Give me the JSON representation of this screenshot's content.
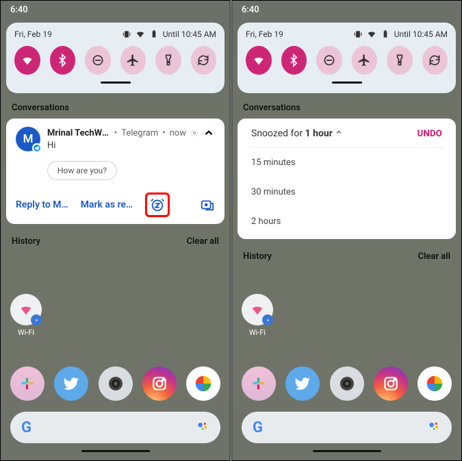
{
  "status": {
    "time": "6:40"
  },
  "qs": {
    "date": "Fri, Feb 19",
    "battery_until": "Until 10:45 AM",
    "toggles": [
      {
        "name": "wifi",
        "on": true
      },
      {
        "name": "bluetooth",
        "on": true
      },
      {
        "name": "dnd",
        "on": false
      },
      {
        "name": "airplane",
        "on": false
      },
      {
        "name": "flashlight",
        "on": false
      },
      {
        "name": "rotation",
        "on": false
      }
    ]
  },
  "sections": {
    "conversations": "Conversations",
    "history": "History",
    "clear_all": "Clear all"
  },
  "notification": {
    "avatar_letter": "M",
    "sender": "Mrinal TechWi…",
    "app": "Telegram",
    "time": "now",
    "message": "Hi",
    "suggested_reply": "How are you?",
    "actions": {
      "reply": "Reply to M…",
      "mark_read": "Mark as re…"
    }
  },
  "snooze": {
    "prefix": "Snoozed for ",
    "duration": "1 hour",
    "undo": "UNDO",
    "options": [
      "15 minutes",
      "30 minutes",
      "2 hours"
    ]
  },
  "home": {
    "wifi_shortcut_label": "Wi-Fi"
  }
}
